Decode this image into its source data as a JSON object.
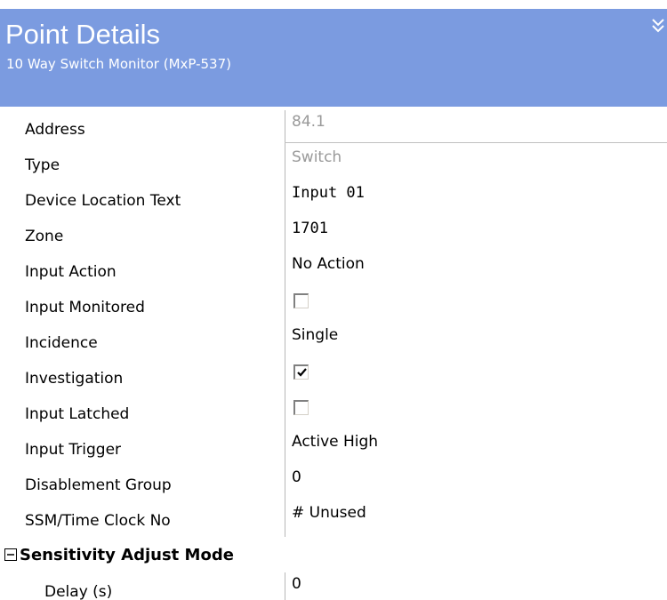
{
  "header": {
    "title": "Point Details",
    "subtitle": "10 Way Switch Monitor (MxP-537)",
    "collapse_icon": "double-chevron-down-icon",
    "background_color": "#7b9be0"
  },
  "properties": [
    {
      "label": "Address",
      "value": "84.1",
      "kind": "text",
      "readonly": true
    },
    {
      "label": "Type",
      "value": "Switch",
      "kind": "text",
      "readonly": true
    },
    {
      "label": "Device Location Text",
      "value": "Input 01",
      "kind": "mono"
    },
    {
      "label": "Zone",
      "value": "1701",
      "kind": "mono"
    },
    {
      "label": "Input Action",
      "value": "No Action",
      "kind": "text"
    },
    {
      "label": "Input Monitored",
      "checked": false,
      "kind": "checkbox"
    },
    {
      "label": "Incidence",
      "value": "Single",
      "kind": "text"
    },
    {
      "label": "Investigation",
      "checked": true,
      "kind": "checkbox"
    },
    {
      "label": "Input Latched",
      "checked": false,
      "kind": "checkbox"
    },
    {
      "label": "Input Trigger",
      "value": "Active High",
      "kind": "text"
    },
    {
      "label": "Disablement Group",
      "value": "0",
      "kind": "text"
    },
    {
      "label": "SSM/Time Clock No",
      "value": "# Unused",
      "kind": "text"
    }
  ],
  "section": {
    "label": "Sensitivity Adjust Mode",
    "expanded": true,
    "expander_icon": "collapse-minus-icon",
    "items": [
      {
        "label": "Delay (s)",
        "value": "0",
        "kind": "text"
      }
    ]
  }
}
